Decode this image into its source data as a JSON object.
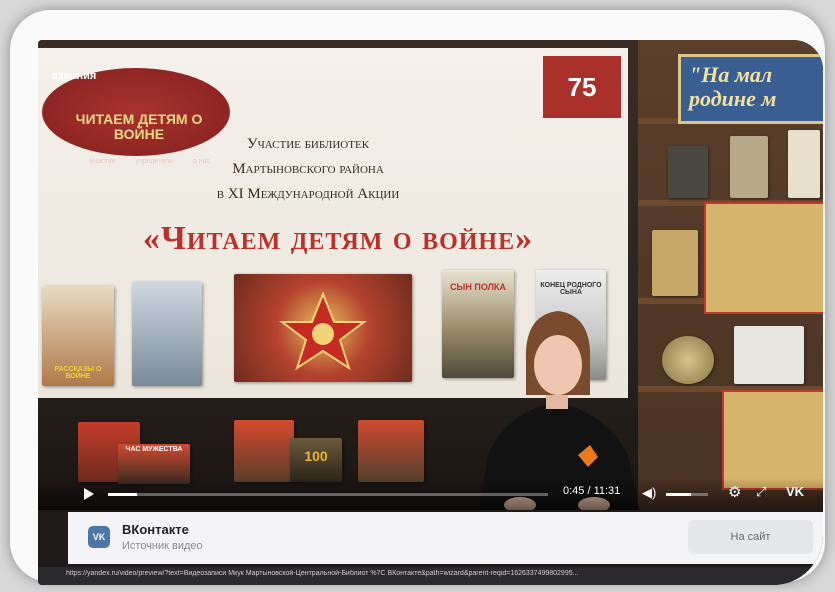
{
  "slide": {
    "stamp_top": "азвания",
    "stamp_title": "ЧИТАЕМ ДЕТЯМ О ВОЙНЕ",
    "stamp_small": [
      "участие",
      "учредители",
      "о нас"
    ],
    "logo_text": "75",
    "heading_lines": [
      "Участие библиотек",
      "Мартыновского района",
      "в XI Международной Акции"
    ],
    "main_title": "«Читаем детям о войне»",
    "book_labels": [
      "РАССКАЗЫ О ВОЙНЕ",
      "СЫН ПОЛКА",
      "КОНЕЦ РОДНОГО СЫНА"
    ],
    "lower_book_labels": [
      "ЧАС МУЖЕСТВА",
      "100"
    ]
  },
  "shelf": {
    "banner_lines": [
      "\"На мал",
      "родине м"
    ]
  },
  "player": {
    "timecode": "0:45 / 11:31",
    "progress_fraction": 0.065,
    "volume_fraction": 0.6,
    "vk_label": "VK"
  },
  "source": {
    "badge": "VK",
    "name": "ВКонтакте",
    "subtitle": "Источник видео",
    "button": "На сайт"
  },
  "url": "https://yandex.ru/video/preview/?text=Видеозаписи Мкук Мартыновской-Центральной-Библиот %7C ВКонтакте&path=wizard&parent-reqid=1626337499802995..."
}
